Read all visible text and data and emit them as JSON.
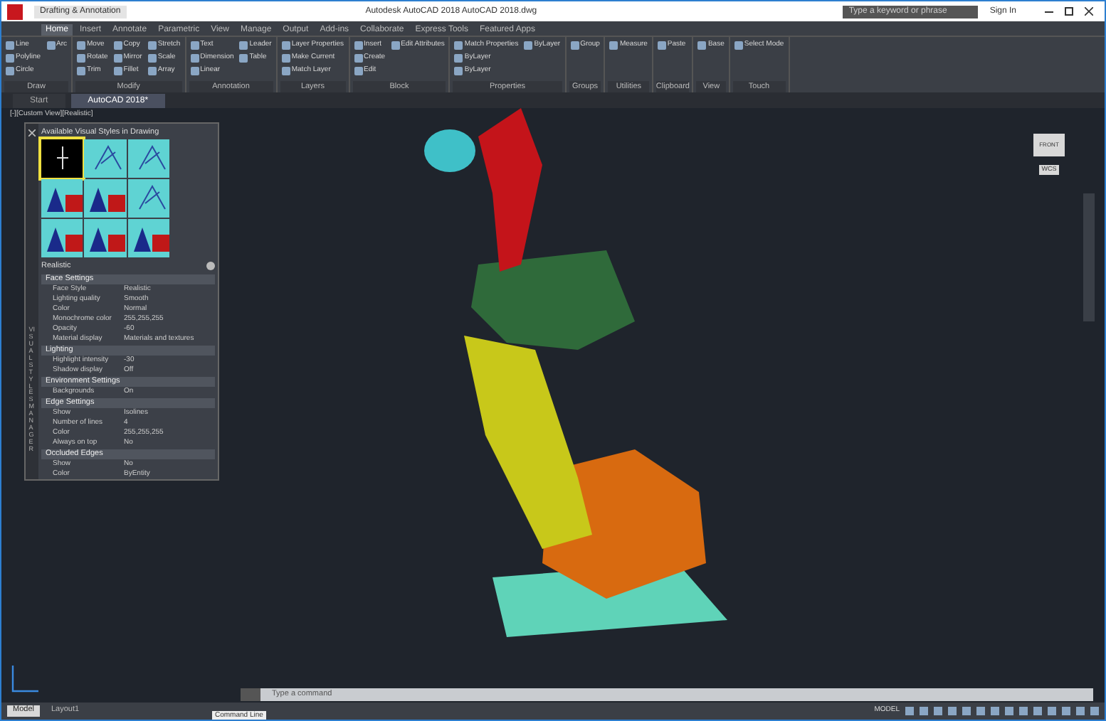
{
  "window": {
    "title": "Autodesk AutoCAD 2018   AutoCAD 2018.dwg",
    "search_placeholder": "Type a keyword or phrase",
    "sign_in": "Sign In"
  },
  "quick_access": {
    "workspace": "Drafting & Annotation"
  },
  "ribbon_tabs": [
    {
      "label": "Home",
      "selected": true
    },
    {
      "label": "Insert",
      "selected": false
    },
    {
      "label": "Annotate",
      "selected": false
    },
    {
      "label": "Parametric",
      "selected": false
    },
    {
      "label": "View",
      "selected": false
    },
    {
      "label": "Manage",
      "selected": false
    },
    {
      "label": "Output",
      "selected": false
    },
    {
      "label": "Add-ins",
      "selected": false
    },
    {
      "label": "Collaborate",
      "selected": false
    },
    {
      "label": "Express Tools",
      "selected": false
    },
    {
      "label": "Featured Apps",
      "selected": false
    }
  ],
  "ribbon_panels": [
    {
      "title": "Draw",
      "tools": [
        "Line",
        "Polyline",
        "Circle",
        "Arc"
      ]
    },
    {
      "title": "Modify",
      "tools": [
        "Move",
        "Rotate",
        "Trim",
        "Copy",
        "Mirror",
        "Fillet",
        "Stretch",
        "Scale",
        "Array"
      ]
    },
    {
      "title": "Annotation",
      "tools": [
        "Text",
        "Dimension",
        "Linear",
        "Leader",
        "Table"
      ]
    },
    {
      "title": "Layers",
      "tools": [
        "Layer Properties",
        "Make Current",
        "Match Layer"
      ]
    },
    {
      "title": "Block",
      "tools": [
        "Insert",
        "Create",
        "Edit",
        "Edit Attributes"
      ]
    },
    {
      "title": "Properties",
      "tools": [
        "Match Properties",
        "ByLayer",
        "ByLayer",
        "ByLayer"
      ]
    },
    {
      "title": "Groups",
      "tools": [
        "Group"
      ]
    },
    {
      "title": "Utilities",
      "tools": [
        "Measure"
      ]
    },
    {
      "title": "Clipboard",
      "tools": [
        "Paste"
      ]
    },
    {
      "title": "View",
      "tools": [
        "Base"
      ]
    },
    {
      "title": "Touch",
      "tools": [
        "Select Mode"
      ]
    }
  ],
  "document_tabs": [
    {
      "label": "Start",
      "selected": false
    },
    {
      "label": "AutoCAD 2018*",
      "selected": true
    }
  ],
  "viewport_label": "[-][Custom View][Realistic]",
  "visual_styles_palette": {
    "title": "Available Visual Styles in Drawing",
    "thumbnails": [
      {
        "kind": "dark",
        "selected": true
      },
      {
        "kind": "lines",
        "selected": false
      },
      {
        "kind": "lines",
        "selected": false
      },
      {
        "kind": "shaded",
        "selected": false
      },
      {
        "kind": "shaded",
        "selected": false
      },
      {
        "kind": "lines",
        "selected": false
      },
      {
        "kind": "shaded",
        "selected": false
      },
      {
        "kind": "shaded",
        "selected": false
      },
      {
        "kind": "shaded",
        "selected": false
      }
    ],
    "current": "Realistic",
    "sections": [
      {
        "title": "Face Settings",
        "rows": [
          [
            "Face Style",
            "Realistic"
          ],
          [
            "Lighting quality",
            "Smooth"
          ],
          [
            "Color",
            "Normal"
          ],
          [
            "Monochrome color",
            "255,255,255"
          ],
          [
            "Opacity",
            "-60"
          ],
          [
            "Material display",
            "Materials and textures"
          ]
        ]
      },
      {
        "title": "Lighting",
        "rows": [
          [
            "Highlight intensity",
            "-30"
          ],
          [
            "Shadow display",
            "Off"
          ]
        ]
      },
      {
        "title": "Environment Settings",
        "rows": [
          [
            "Backgrounds",
            "On"
          ]
        ]
      },
      {
        "title": "Edge Settings",
        "rows": [
          [
            "Show",
            "Isolines"
          ],
          [
            "Number of lines",
            "4"
          ],
          [
            "Color",
            "255,255,255"
          ],
          [
            "Always on top",
            "No"
          ]
        ]
      },
      {
        "title": "Occluded Edges",
        "rows": [
          [
            "Show",
            "No"
          ],
          [
            "Color",
            "ByEntity"
          ]
        ]
      }
    ],
    "side_label": "VISUAL STYLES MANAGER"
  },
  "viewcube": {
    "face": "FRONT",
    "wcs": "WCS"
  },
  "command_line": {
    "placeholder": "Type a command"
  },
  "layout_tabs": [
    {
      "label": "Model",
      "selected": true
    },
    {
      "label": "Layout1",
      "selected": false
    }
  ],
  "tooltip": "Command Line",
  "status": {
    "model": "MODEL"
  }
}
